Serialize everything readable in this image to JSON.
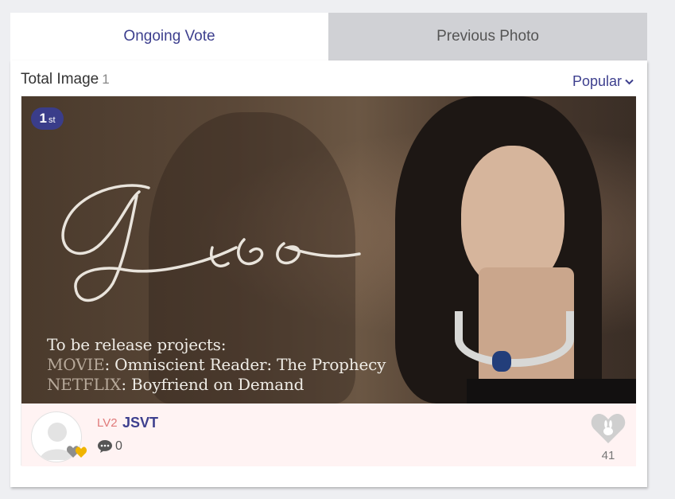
{
  "tabs": [
    {
      "label": "Ongoing Vote",
      "active": true
    },
    {
      "label": "Previous Photo",
      "active": false
    }
  ],
  "summary": {
    "label": "Total Image",
    "count": "1"
  },
  "sort": {
    "selected": "Popular"
  },
  "card": {
    "rank": {
      "number": "1",
      "suffix": "st"
    },
    "image_text": {
      "signature": "Jisoo",
      "line1": "To be release projects:",
      "line2_prefix": "MOVIE",
      "line2": ": Omniscient Reader: The Prophecy",
      "line3_prefix": "NETFLIX",
      "line3": ": Boyfriend on Demand"
    },
    "uploader": {
      "level": "LV2",
      "name": "JSVT"
    },
    "comments": "0",
    "likes": "41"
  },
  "colors": {
    "accent": "#3d3f8e",
    "level": "#e07a7a",
    "info_bg": "#fff3f3",
    "inactive_tab": "#d0d1d5"
  },
  "icons": [
    "chevron-down-icon",
    "comment-icon",
    "heart-rabbit-icon",
    "avatar-placeholder-icon",
    "fan-hearts-icon"
  ]
}
